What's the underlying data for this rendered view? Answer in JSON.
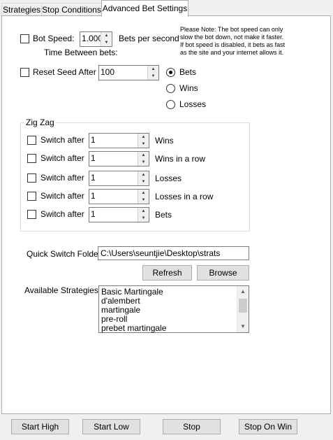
{
  "tabs": [
    {
      "label": "Strategies"
    },
    {
      "label": "Stop Conditions"
    },
    {
      "label": "Advanced Bet Settings"
    }
  ],
  "bot_speed": {
    "checkbox_label": "Bot Speed:",
    "value": "1.000",
    "unit_label": "Bets per second",
    "sub_label": "Time Between bets:",
    "checked": false
  },
  "note": {
    "lines": [
      "Please Note: The bot speed can only",
      "slow the bot down, not make it faster.",
      "If bot speed is disabled, it bets as fast",
      "as the site and your internet allows it."
    ]
  },
  "reset_seed": {
    "checkbox_label": "Reset Seed After",
    "value": "100",
    "checked": false,
    "options": [
      {
        "label": "Bets",
        "selected": true
      },
      {
        "label": "Wins",
        "selected": false
      },
      {
        "label": "Losses",
        "selected": false
      }
    ]
  },
  "zigzag": {
    "title": "Zig Zag",
    "rows": [
      {
        "checkbox_label": "Switch after",
        "value": "1",
        "unit": "Wins"
      },
      {
        "checkbox_label": "Switch after",
        "value": "1",
        "unit": "Wins in a row"
      },
      {
        "checkbox_label": "Switch after",
        "value": "1",
        "unit": "Losses"
      },
      {
        "checkbox_label": "Switch after",
        "value": "1",
        "unit": "Losses in a row"
      },
      {
        "checkbox_label": "Switch after",
        "value": "1",
        "unit": "Bets"
      }
    ]
  },
  "quick_switch": {
    "label": "Quick Switch Folder:",
    "path": "C:\\Users\\seuntjie\\Desktop\\strats",
    "refresh_label": "Refresh",
    "browse_label": "Browse"
  },
  "available": {
    "label": "Available Strategies:",
    "items": [
      "Basic Martingale",
      "d'alembert",
      "martingale",
      "pre-roll",
      "prebet martingale"
    ]
  },
  "bottom_buttons": {
    "start_high": "Start High",
    "start_low": "Start Low",
    "stop": "Stop",
    "stop_on_win": "Stop On Win"
  },
  "icons": {
    "spin_up": "up-arrow-icon",
    "spin_down": "down-arrow-icon"
  }
}
